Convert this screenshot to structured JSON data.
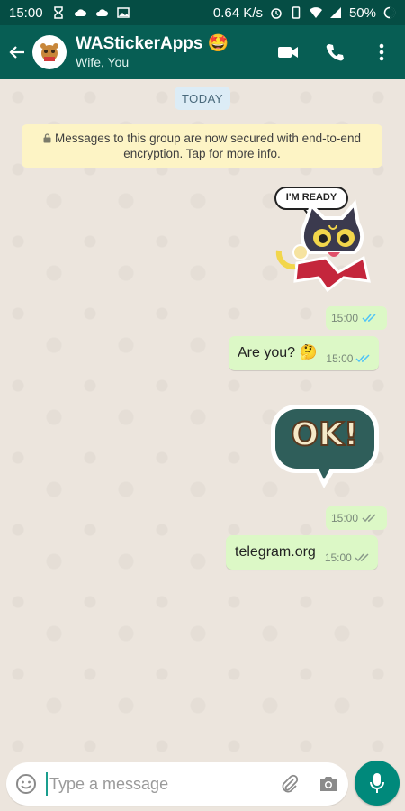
{
  "status_bar": {
    "time": "15:00",
    "net_speed": "0.64 K/s",
    "battery": "50%"
  },
  "header": {
    "title": "WAStickerApps",
    "title_emoji": "🤩",
    "subtitle": "Wife, You"
  },
  "chat": {
    "date_chip": "TODAY",
    "encryption_notice": "Messages to this group are now secured with end-to-end encryption. Tap for more info.",
    "sticker_1_caption": "I'M READY",
    "sticker_1_time": "15:00",
    "message_1_text": "Are you? 🤔",
    "message_1_time": "15:00",
    "sticker_2_text": "OK!",
    "sticker_2_time": "15:00",
    "message_2_text": "telegram.org",
    "message_2_time": "15:00"
  },
  "composer": {
    "placeholder": "Type a message"
  },
  "colors": {
    "header": "#075e54",
    "status_bar": "#054d44",
    "bubble_out": "#dcf8c6",
    "read_ticks": "#4fc3f7",
    "mic_button": "#00897b",
    "link": "#2a8bd1"
  },
  "icons": [
    "hourglass-icon",
    "cloud-icon",
    "cloud-icon",
    "image-icon",
    "alarm-icon",
    "phone-icon",
    "wifi-icon",
    "signal-icon",
    "battery-icon",
    "back-arrow-icon",
    "video-call-icon",
    "voice-call-icon",
    "more-vert-icon",
    "lock-icon",
    "double-tick-icon",
    "emoji-icon",
    "attach-icon",
    "camera-icon",
    "mic-icon"
  ]
}
